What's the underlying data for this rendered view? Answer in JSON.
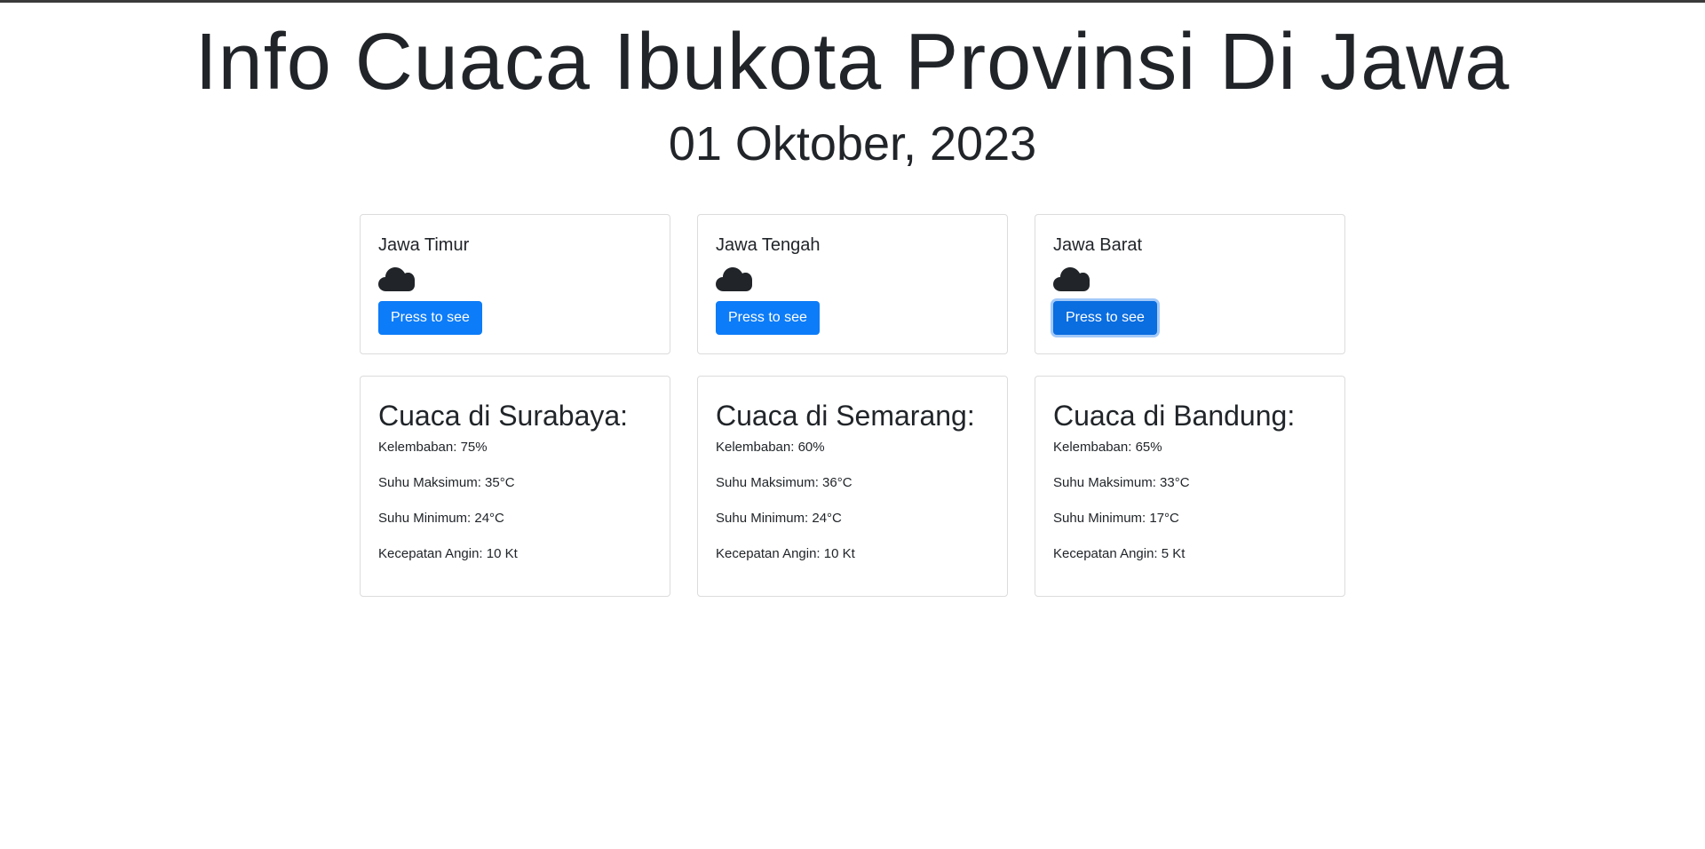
{
  "header": {
    "title": "Info Cuaca Ibukota Provinsi Di Jawa",
    "date": "01 Oktober, 2023"
  },
  "button_label": "Press to see",
  "icon": "cloud-icon",
  "colors": {
    "button": "#0d7cf8",
    "text": "#212529",
    "border": "#dcdcdc"
  },
  "provinces": [
    {
      "name": "Jawa Timur"
    },
    {
      "name": "Jawa Tengah"
    },
    {
      "name": "Jawa Barat"
    }
  ],
  "weather": [
    {
      "title": "Cuaca di Surabaya:",
      "humidity": "Kelembaban: 75%",
      "max_temp": "Suhu Maksimum: 35°C",
      "min_temp": "Suhu Minimum: 24°C",
      "wind": "Kecepatan Angin: 10 Kt"
    },
    {
      "title": "Cuaca di Semarang:",
      "humidity": "Kelembaban: 60%",
      "max_temp": "Suhu Maksimum: 36°C",
      "min_temp": "Suhu Minimum: 24°C",
      "wind": "Kecepatan Angin: 10 Kt"
    },
    {
      "title": "Cuaca di Bandung:",
      "humidity": "Kelembaban: 65%",
      "max_temp": "Suhu Maksimum: 33°C",
      "min_temp": "Suhu Minimum: 17°C",
      "wind": "Kecepatan Angin: 5 Kt"
    }
  ]
}
